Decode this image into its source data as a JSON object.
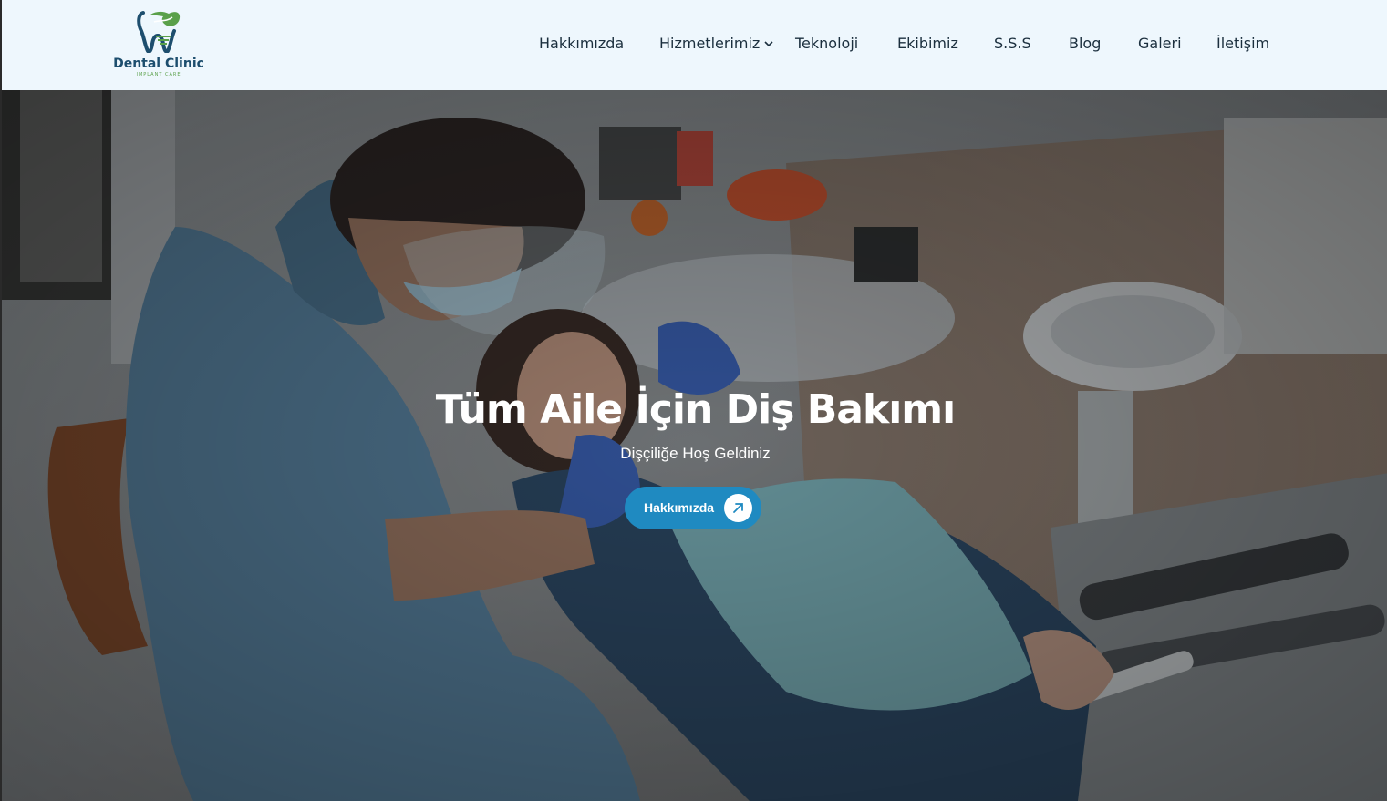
{
  "brand": {
    "name": "Dental Clinic",
    "tagline": "IMPLANT CARE",
    "logo_icon": "tooth-leaf-icon",
    "colors": {
      "primary": "#1d4e6e",
      "leaf": "#5aa04a",
      "accent": "#1f8ac1"
    }
  },
  "nav": {
    "items": [
      {
        "label": "Hakkımızda"
      },
      {
        "label": "Hizmetlerimiz",
        "has_dropdown": true
      },
      {
        "label": "Teknoloji"
      },
      {
        "label": "Ekibimiz"
      },
      {
        "label": "S.S.S"
      },
      {
        "label": "Blog"
      },
      {
        "label": "Galeri"
      },
      {
        "label": "İletişim"
      }
    ]
  },
  "hero": {
    "title": "Tüm Aile İçin Diş Bakımı",
    "subtitle": "Dişçiliğe Hoş Geldiniz",
    "button_label": "Hakkımızda",
    "button_icon": "arrow-up-right-icon",
    "background_image": "dentist-treating-patient-photo"
  }
}
